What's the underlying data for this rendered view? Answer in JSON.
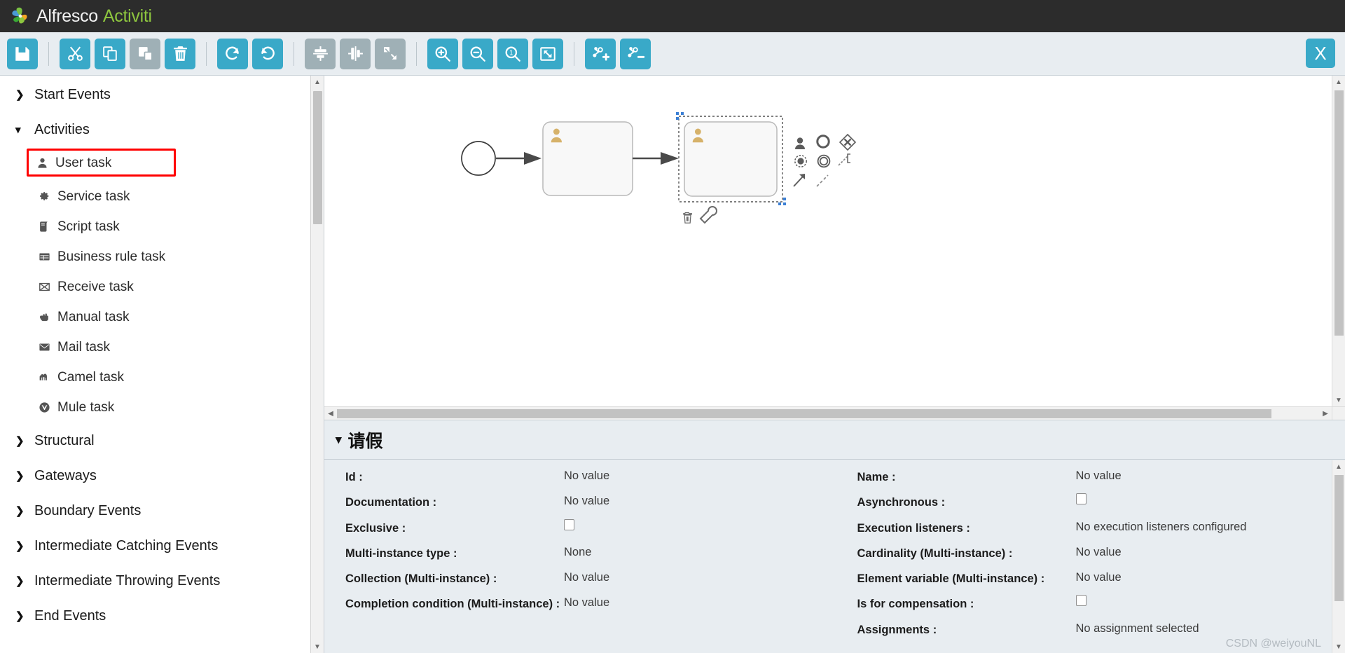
{
  "brand": {
    "primary": "Alfresco",
    "secondary": "Activiti",
    "logo_icon": "alfresco-pinwheel-icon"
  },
  "colors": {
    "accent": "#39a9c8",
    "disabled": "#9fb0b6",
    "brand_green": "#8ec63f",
    "highlight": "#ff0000",
    "panel_bg": "#e8edf1"
  },
  "toolbar": {
    "close_label": "X",
    "buttons": [
      {
        "name": "save-button",
        "icon": "save-icon",
        "enabled": true
      },
      {
        "name": "cut-button",
        "icon": "scissors-icon",
        "enabled": true
      },
      {
        "name": "copy-button",
        "icon": "copy-icon",
        "enabled": true
      },
      {
        "name": "paste-button",
        "icon": "paste-icon",
        "enabled": false
      },
      {
        "name": "delete-button",
        "icon": "trash-icon",
        "enabled": true
      },
      {
        "name": "redo-button",
        "icon": "redo-arrow-icon",
        "enabled": true
      },
      {
        "name": "undo-button",
        "icon": "undo-arrow-icon",
        "enabled": true
      },
      {
        "name": "align-vertical-button",
        "icon": "align-vertical-icon",
        "enabled": false
      },
      {
        "name": "align-horizontal-button",
        "icon": "align-horizontal-icon",
        "enabled": false
      },
      {
        "name": "same-size-button",
        "icon": "resize-same-size-icon",
        "enabled": false
      },
      {
        "name": "zoom-in-button",
        "icon": "zoom-in-icon",
        "enabled": true
      },
      {
        "name": "zoom-out-button",
        "icon": "zoom-out-icon",
        "enabled": true
      },
      {
        "name": "zoom-actual-button",
        "icon": "zoom-actual-size-icon",
        "enabled": true
      },
      {
        "name": "zoom-fit-button",
        "icon": "zoom-fit-diagram-icon",
        "enabled": true
      },
      {
        "name": "add-bendpoint-button",
        "icon": "add-bendpoint-icon",
        "enabled": true
      },
      {
        "name": "remove-bendpoint-button",
        "icon": "remove-bendpoint-icon",
        "enabled": true
      }
    ]
  },
  "palette": {
    "groups": [
      {
        "label": "Start Events",
        "expanded": false,
        "items": []
      },
      {
        "label": "Activities",
        "expanded": true,
        "items": [
          {
            "label": "User task",
            "icon": "user-icon",
            "highlighted": true
          },
          {
            "label": "Service task",
            "icon": "gear-icon",
            "highlighted": false
          },
          {
            "label": "Script task",
            "icon": "script-icon",
            "highlighted": false
          },
          {
            "label": "Business rule task",
            "icon": "table-icon",
            "highlighted": false
          },
          {
            "label": "Receive task",
            "icon": "envelope-outline-icon",
            "highlighted": false
          },
          {
            "label": "Manual task",
            "icon": "hand-icon",
            "highlighted": false
          },
          {
            "label": "Mail task",
            "icon": "mail-icon",
            "highlighted": false
          },
          {
            "label": "Camel task",
            "icon": "camel-icon",
            "highlighted": false
          },
          {
            "label": "Mule task",
            "icon": "mule-icon",
            "highlighted": false
          }
        ]
      },
      {
        "label": "Structural",
        "expanded": false,
        "items": []
      },
      {
        "label": "Gateways",
        "expanded": false,
        "items": []
      },
      {
        "label": "Boundary Events",
        "expanded": false,
        "items": []
      },
      {
        "label": "Intermediate Catching Events",
        "expanded": false,
        "items": []
      },
      {
        "label": "Intermediate Throwing Events",
        "expanded": false,
        "items": []
      },
      {
        "label": "End Events",
        "expanded": false,
        "items": []
      }
    ],
    "collapsed_chevron": "❯",
    "expanded_chevron": "⌄"
  },
  "canvas": {
    "elements": [
      {
        "name": "start-event",
        "type": "start-event"
      },
      {
        "name": "user-task-1",
        "type": "user-task",
        "selected": false
      },
      {
        "name": "user-task-2",
        "type": "user-task",
        "selected": true
      }
    ],
    "quick_menu": [
      "user-task-icon",
      "end-event-icon",
      "gateway-icon",
      "boundary-timer-icon",
      "intermediate-event-icon",
      "text-annotation-icon",
      "sequence-flow-icon",
      "association-icon"
    ],
    "selection_actions": [
      "delete-icon",
      "morph-wrench-icon"
    ]
  },
  "properties": {
    "title": "请假",
    "collapse_chevron": "⌄",
    "left_column": [
      {
        "label": "Id :",
        "value": "No value",
        "type": "text"
      },
      {
        "label": "Documentation :",
        "value": "No value",
        "type": "text"
      },
      {
        "label": "Exclusive :",
        "value": "",
        "type": "checkbox",
        "checked": false
      },
      {
        "label": "Multi-instance type :",
        "value": "None",
        "type": "text"
      },
      {
        "label": "Collection (Multi-instance) :",
        "value": "No value",
        "type": "text"
      },
      {
        "label": "Completion condition (Multi-instance) :",
        "value": "No value",
        "type": "text"
      }
    ],
    "right_column": [
      {
        "label": "Name :",
        "value": "No value",
        "type": "text"
      },
      {
        "label": "Asynchronous :",
        "value": "",
        "type": "checkbox",
        "checked": false
      },
      {
        "label": "Execution listeners :",
        "value": "No execution listeners configured",
        "type": "text"
      },
      {
        "label": "Cardinality (Multi-instance) :",
        "value": "No value",
        "type": "text"
      },
      {
        "label": "Element variable (Multi-instance) :",
        "value": "No value",
        "type": "text"
      },
      {
        "label": "Is for compensation :",
        "value": "",
        "type": "checkbox",
        "checked": false
      },
      {
        "label": "Assignments :",
        "value": "No assignment selected",
        "type": "text"
      }
    ]
  },
  "watermark": "CSDN @weiyouNL"
}
